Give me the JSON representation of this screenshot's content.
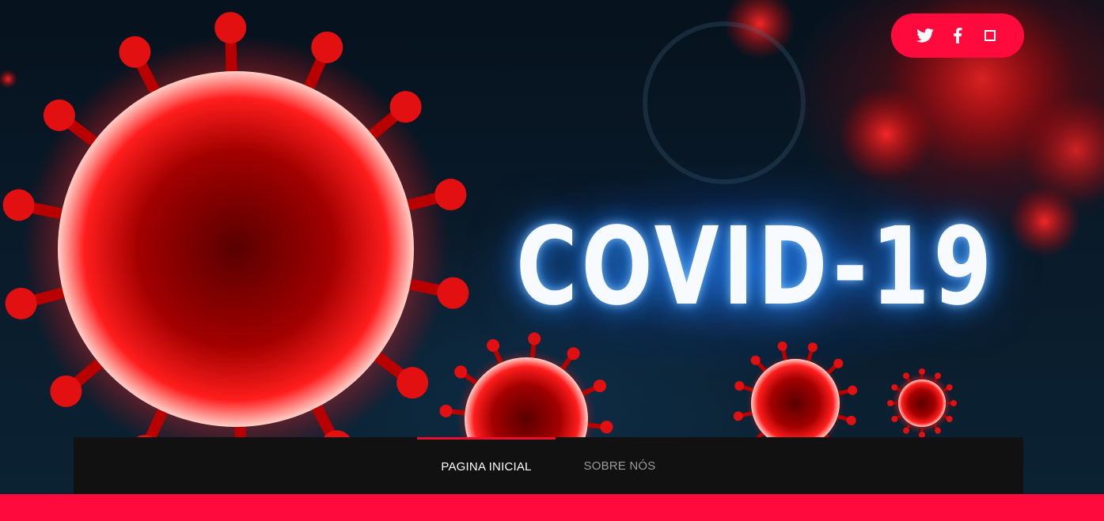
{
  "hero": {
    "title": "COVID-19",
    "image": "coronavirus-banner"
  },
  "social": {
    "twitter_icon": "twitter-icon",
    "facebook_icon": "facebook-icon",
    "instagram_icon": "instagram-icon",
    "background_color": "#ff0a3c"
  },
  "nav": {
    "items": [
      {
        "label": "PAGINA INICIAL",
        "active": true
      },
      {
        "label": "SOBRE NÓS",
        "active": false
      }
    ],
    "active_color": "#e8102e"
  },
  "colors": {
    "accent": "#ff0a3c",
    "navbar": "#111111"
  }
}
